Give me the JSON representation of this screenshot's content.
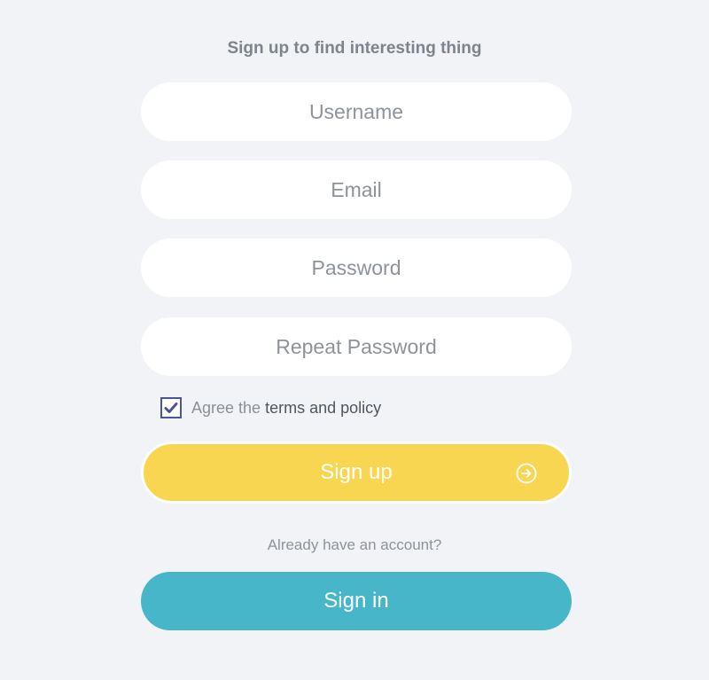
{
  "form": {
    "heading": "Sign up to find interesting thing",
    "username": {
      "placeholder": "Username",
      "value": ""
    },
    "email": {
      "placeholder": "Email",
      "value": ""
    },
    "password": {
      "placeholder": "Password",
      "value": ""
    },
    "repeat_password": {
      "placeholder": "Repeat Password",
      "value": ""
    },
    "agree": {
      "checked": true,
      "prefix": "Agree the",
      "link_text": "terms and policy"
    },
    "signup_button": {
      "label": "Sign up",
      "icon": "arrow-right-circle-icon"
    },
    "already_text": "Already have an account?",
    "signin_button": {
      "label": "Sign in"
    }
  },
  "colors": {
    "background": "#f1f3f7",
    "signup_button": "#f9d652",
    "signin_button": "#47b6c9",
    "checkbox_border": "#4a5499",
    "heading_text": "#7d848c"
  }
}
